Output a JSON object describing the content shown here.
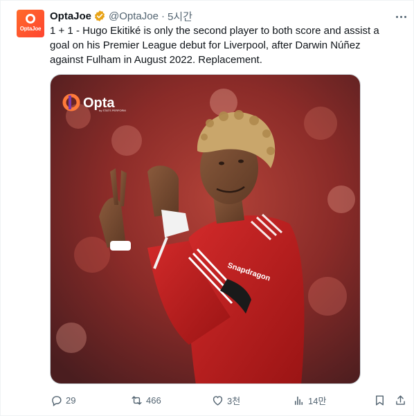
{
  "tweet": {
    "author_name": "OptaJoe",
    "handle": "@OptaJoe",
    "separator": "·",
    "time": "5시간",
    "avatar_text": "OptaJoe",
    "text": "1 + 1 - Hugo Ekitiké is only the second player to both score and assist a goal on his Premier League debut for Liverpool, after Darwin Núñez against Fulham in August 2022. Replacement.",
    "media": {
      "logo_word": "Opta",
      "logo_sub": "by STATS PERFORM",
      "shirt_sponsor": "Snapdragon"
    }
  },
  "actions": {
    "replies": "29",
    "reposts": "466",
    "likes": "3천",
    "views": "14만"
  },
  "colors": {
    "verified": "#e8a317",
    "text_primary": "#0f1419",
    "text_secondary": "#536471",
    "repost_accent": "#536471",
    "brand_orange": "#ff5a2e"
  },
  "icons": [
    "more-icon",
    "verified-badge-icon",
    "reply-icon",
    "repost-icon",
    "like-icon",
    "views-icon",
    "bookmark-icon",
    "share-icon"
  ]
}
